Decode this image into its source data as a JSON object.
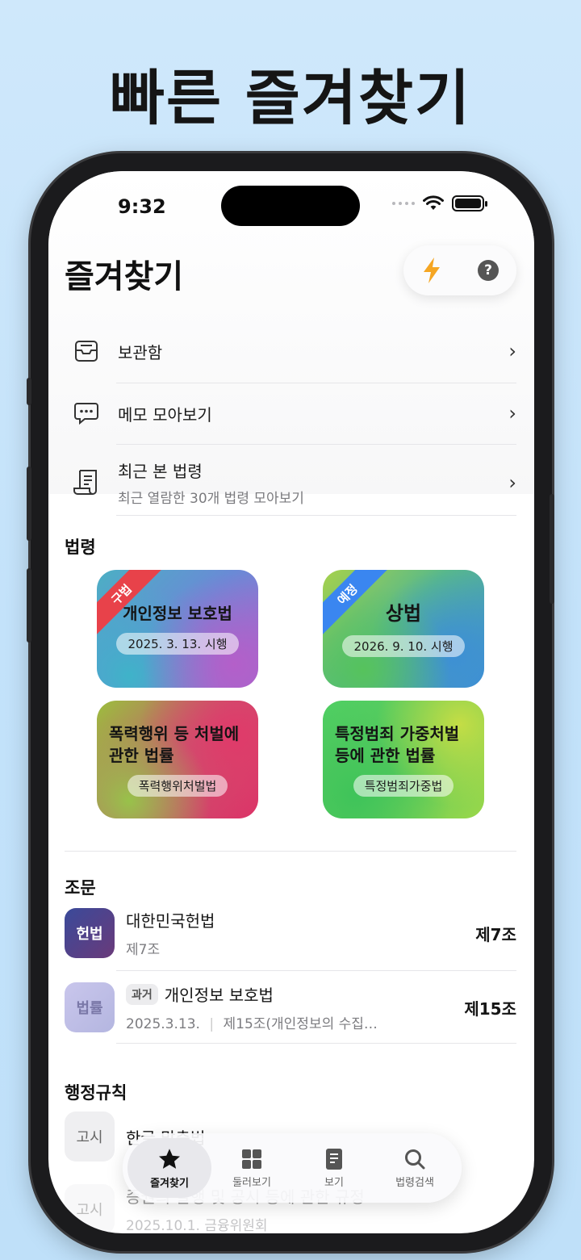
{
  "headline": "빠른 즐겨찾기",
  "status": {
    "time": "9:32"
  },
  "page": {
    "title": "즐겨찾기"
  },
  "menu": [
    {
      "label": "보관함",
      "sub": ""
    },
    {
      "label": "메모 모아보기",
      "sub": ""
    },
    {
      "label": "최근 본 법령",
      "sub": "최근 열람한 30개 법령 모아보기"
    }
  ],
  "laws": {
    "heading": "법령",
    "cards": [
      {
        "title": "개인정보 보호법",
        "pill": "2025. 3. 13. 시행",
        "ribbon": "구법",
        "ribbon_color": "#e8424a"
      },
      {
        "title": "상법",
        "pill": "2026. 9. 10. 시행",
        "ribbon": "예정",
        "ribbon_color": "#3a86f0"
      },
      {
        "title": "폭력행위 등 처벌에 관한 법률",
        "pill": "폭력행위처벌법",
        "ribbon": "",
        "ribbon_color": ""
      },
      {
        "title": "특정범죄 가중처벌 등에 관한 법률",
        "pill": "특정범죄가중법",
        "ribbon": "",
        "ribbon_color": ""
      }
    ]
  },
  "articles": {
    "heading": "조문",
    "items": [
      {
        "badge": "헌법",
        "name": "대한민국헌법",
        "tag": "",
        "sub_date": "",
        "sub": "제7조",
        "right": "제7조"
      },
      {
        "badge": "법률",
        "name": "개인정보 보호법",
        "tag": "과거",
        "sub_date": "2025.3.13.",
        "sub": "제15조(개인정보의 수집…",
        "right": "제15조"
      }
    ]
  },
  "rules": {
    "heading": "행정규칙",
    "items": [
      {
        "badge": "고시",
        "name": "한글 맞춤법",
        "sub": ""
      },
      {
        "badge": "고시",
        "name": "증권의 발행 및 공시 등에 관한 규정",
        "sub": "2025.10.1.   금융위원회"
      }
    ]
  },
  "tabs": [
    {
      "label": "즐겨찾기",
      "icon": "star-icon",
      "active": true
    },
    {
      "label": "둘러보기",
      "icon": "grid-icon",
      "active": false
    },
    {
      "label": "보기",
      "icon": "document-icon",
      "active": false
    },
    {
      "label": "법령검색",
      "icon": "search-icon",
      "active": false
    }
  ],
  "colors": {
    "accent_orange": "#f5a623",
    "text": "#111111"
  }
}
